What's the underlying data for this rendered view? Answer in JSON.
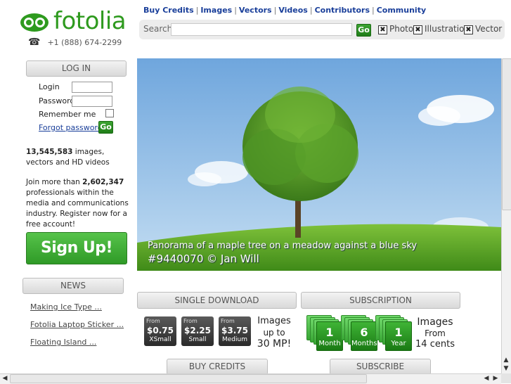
{
  "brand": {
    "name": "fotolia",
    "phone": "+1 (888) 674-2299",
    "color": "#2e9a1e"
  },
  "nav": {
    "items": [
      "Buy Credits",
      "Images",
      "Vectors",
      "Videos",
      "Contributors",
      "Community"
    ],
    "separator": "|"
  },
  "search": {
    "label": "Search",
    "value": "",
    "go_label": "Go",
    "filters": [
      {
        "label": "Photo",
        "checked": true
      },
      {
        "label": "Illustration",
        "checked": true
      },
      {
        "label": "Vector",
        "checked": true
      }
    ]
  },
  "login": {
    "title": "LOG IN",
    "login_label": "Login",
    "password_label": "Password",
    "remember_label": "Remember me",
    "forgot_label": "Forgot password",
    "go_label": "Go"
  },
  "stats": {
    "images_count": "13,545,583",
    "images_text": "images, vectors and HD videos",
    "join_prefix": "Join more than",
    "pros_count": "2,602,347",
    "join_text": "professionals within the media and communications industry. Register now for a free account!"
  },
  "signup_label": "Sign Up!",
  "news": {
    "title": "NEWS",
    "items": [
      "Making Ice Type ...",
      "Fotolia Laptop Sticker ...",
      "Floating Island ..."
    ]
  },
  "hero": {
    "caption": "Panorama of a maple tree on a meadow against a blue sky",
    "credit": "#9440070  © Jan Will"
  },
  "single_download": {
    "title": "SINGLE DOWNLOAD",
    "prices": [
      {
        "from": "From",
        "value": "$0.75",
        "size": "XSmall"
      },
      {
        "from": "From",
        "value": "$2.25",
        "size": "Small"
      },
      {
        "from": "From",
        "value": "$3.75",
        "size": "Medium"
      }
    ],
    "images_line1": "Images",
    "images_line2": "up to",
    "images_line3": "30 MP!",
    "button": "BUY CREDITS"
  },
  "subscription": {
    "title": "SUBSCRIPTION",
    "plans": [
      {
        "num": "1",
        "unit": "Month"
      },
      {
        "num": "6",
        "unit": "Months"
      },
      {
        "num": "1",
        "unit": "Year"
      }
    ],
    "images_line1": "Images",
    "images_line2": "From",
    "images_line3": "14 cents",
    "button": "SUBSCRIBE"
  }
}
